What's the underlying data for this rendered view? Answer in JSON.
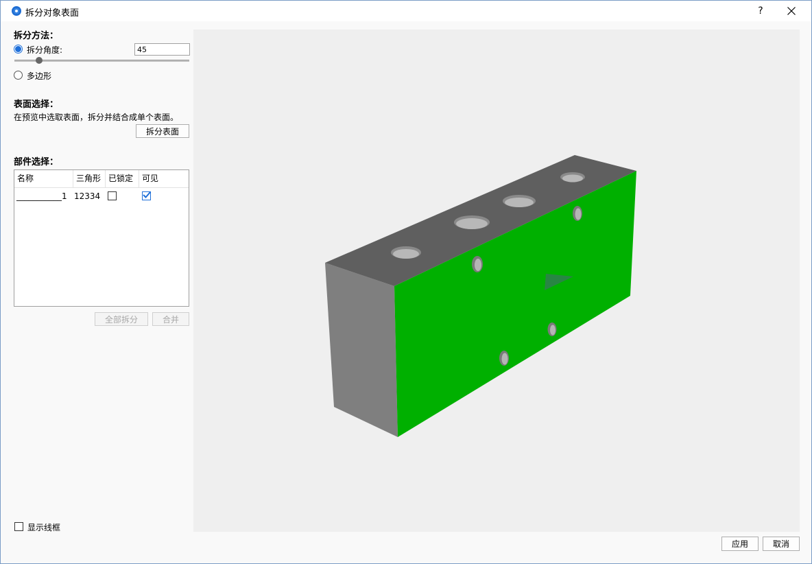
{
  "window": {
    "title": "拆分对象表面",
    "help_label": "?"
  },
  "split_method": {
    "heading": "拆分方法：",
    "angle_label": "拆分角度:",
    "angle_value": "45",
    "polygon_label": "多边形",
    "selected": "angle",
    "slider_level_fraction": 0.125
  },
  "surface_selection": {
    "heading": "表面选择：",
    "description": "在预览中选取表面，拆分并结合成单个表面。",
    "split_button": "拆分表面"
  },
  "part_selection": {
    "heading": "部件选择：",
    "columns": [
      "名称",
      "三角形",
      "已锁定",
      "可见"
    ],
    "rows": [
      {
        "name": "___________1",
        "triangles": "12334",
        "locked": false,
        "visible": true
      }
    ],
    "split_all_button": "全部拆分",
    "merge_button": "合并"
  },
  "show_wireframe": {
    "label": "显示线框",
    "checked": false
  },
  "footer": {
    "apply_button": "应用",
    "cancel_button": "取消"
  },
  "preview": {
    "background_color": "#efefef",
    "selected_face_color": "#00b000",
    "model_face_color": "#7f7f7f",
    "model_top_color": "#5f5f5f"
  }
}
